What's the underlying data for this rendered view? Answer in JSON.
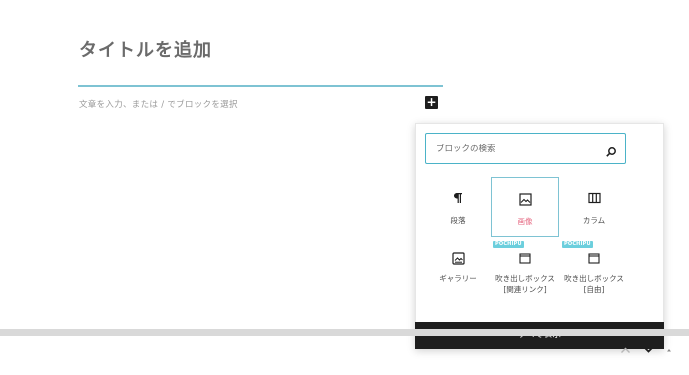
{
  "editor": {
    "title_placeholder": "タイトルを追加",
    "paragraph_placeholder": "文章を入力、または / でブロックを選択",
    "inserter_toggle_glyph": "+"
  },
  "inserter": {
    "search": {
      "placeholder": "ブロックの検索",
      "value": ""
    },
    "badge_text": "POCHIPU",
    "blocks": [
      {
        "label": "段落",
        "icon": "paragraph-icon",
        "selected": false
      },
      {
        "label": "画像",
        "icon": "image-icon",
        "selected": true
      },
      {
        "label": "カラム",
        "icon": "columns-icon",
        "selected": false
      },
      {
        "label": "ギャラリー",
        "icon": "gallery-icon",
        "selected": false
      },
      {
        "label": "吹き出しボックス[関連リンク]",
        "icon": "window-icon",
        "selected": false,
        "badge": true
      },
      {
        "label": "吹き出しボックス[自由]",
        "icon": "window-icon",
        "selected": false,
        "badge": true
      }
    ],
    "show_all_label": "すべて表示"
  },
  "colors": {
    "accent": "#4bb3c8",
    "selected_label": "#e66a83",
    "badge": "#6ccfdd",
    "dark": "#1e1e1e"
  },
  "nav": {
    "up_icon": "chevron-up-icon",
    "down_icon": "chevron-down-icon",
    "small_up_icon": "caret-up-icon"
  }
}
